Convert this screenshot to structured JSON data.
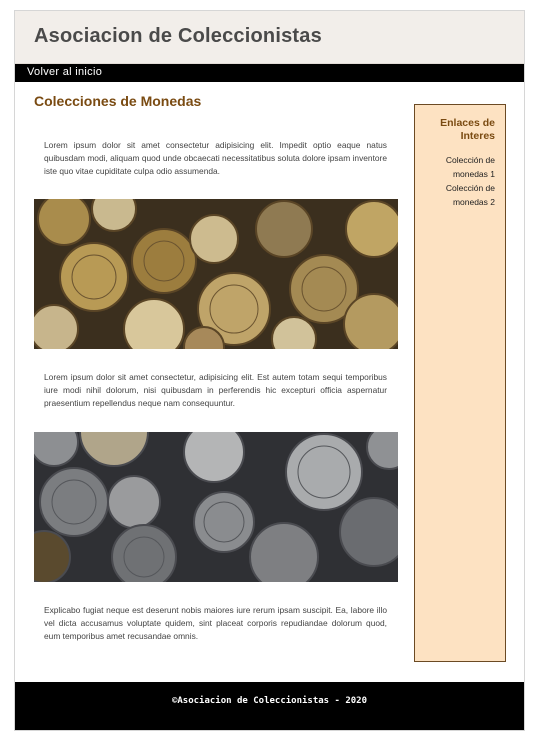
{
  "header": {
    "title": "Asociacion de Coleccionistas"
  },
  "nav": {
    "home_link": "Volver al inicio"
  },
  "main": {
    "heading": "Colecciones de Monedas",
    "paragraphs": [
      "Lorem ipsum dolor sit amet consectetur adipisicing elit. Impedit optio eaque natus quibusdam modi, aliquam quod unde obcaecati necessitatibus soluta dolore ipsam inventore iste quo vitae cupiditate culpa odio assumenda.",
      "Lorem ipsum dolor sit amet consectetur, adipisicing elit. Est autem totam sequi temporibus iure modi nihil dolorum, nisi quibusdam in perferendis hic excepturi officia aspernatur praesentium repellendus neque nam consequuntur.",
      "Explicabo fugiat neque est deserunt nobis maiores iure rerum ipsam suscipit. Ea, labore illo vel dicta accusamus voluptate quidem, sint placeat corporis repudiandae dolorum quod, eum temporibus amet recusandae omnis."
    ]
  },
  "aside": {
    "title": "Enlaces de Interes",
    "links": [
      "Colección de monedas 1",
      "Colección de monedas 2"
    ]
  },
  "footer": {
    "text": "©Asociacion de Coleccionistas - 2020"
  },
  "colors": {
    "accent": "#7a4b12",
    "aside_bg": "#fde2c2",
    "header_bg": "#f2eeea"
  }
}
